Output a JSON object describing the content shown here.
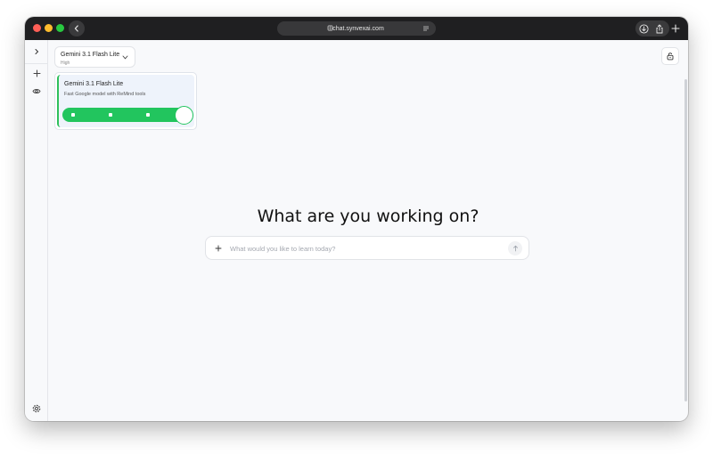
{
  "browser": {
    "url": "chat.synvexai.com"
  },
  "model_selector": {
    "name": "Gemini 3.1 Flash Lite",
    "effort": "High"
  },
  "model_card": {
    "title": "Gemini 3.1 Flash Lite",
    "description": "Fast Google model with ReMind tools",
    "slider_level": 1.0
  },
  "main": {
    "headline": "What are you working on?",
    "chat_placeholder": "What would you like to learn today?"
  },
  "colors": {
    "accent_green": "#22c55e",
    "titlebar": "#1f1f21"
  },
  "icons": {
    "back": "chevron-left-icon",
    "reader": "reader-icon",
    "download": "download-icon",
    "share": "share-icon",
    "new_tab": "plus-icon",
    "sidebar_toggle": "chevron-right-icon",
    "new_chat": "plus-icon",
    "history": "eye-icon",
    "settings": "gear-icon",
    "lock": "lock-icon",
    "attach": "plus-icon",
    "send": "arrow-up-icon"
  }
}
